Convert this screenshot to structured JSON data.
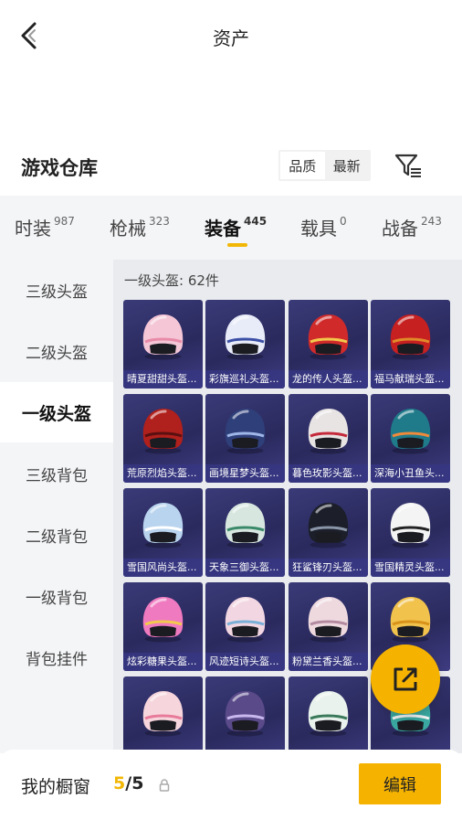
{
  "header": {
    "title": "资产"
  },
  "section": {
    "title": "游戏仓库"
  },
  "sort": {
    "options": [
      "品质",
      "最新"
    ],
    "active": "品质"
  },
  "tabs": [
    {
      "label": "时装",
      "count": "987"
    },
    {
      "label": "枪械",
      "count": "323"
    },
    {
      "label": "装备",
      "count": "445",
      "active": true
    },
    {
      "label": "载具",
      "count": "0"
    },
    {
      "label": "战备",
      "count": "243"
    }
  ],
  "sidebar": {
    "items": [
      {
        "label": "三级头盔"
      },
      {
        "label": "二级头盔"
      },
      {
        "label": "一级头盔",
        "active": true
      },
      {
        "label": "三级背包"
      },
      {
        "label": "二级背包"
      },
      {
        "label": "一级背包"
      },
      {
        "label": "背包挂件"
      }
    ]
  },
  "grid": {
    "header": "一级头盔: 62件",
    "items": [
      {
        "name": "晴夏甜甜头盔...",
        "color": "#f4c6d6",
        "accent": "#e88aa8"
      },
      {
        "name": "彩旗巡礼头盔...",
        "color": "#e8ecf8",
        "accent": "#3b4fa6"
      },
      {
        "name": "龙的传人头盔...",
        "color": "#d12a2a",
        "accent": "#f2c94c"
      },
      {
        "name": "福马献瑞头盔...",
        "color": "#c62020",
        "accent": "#e08a2a"
      },
      {
        "name": "荒原烈焰头盔...",
        "color": "#b0201c",
        "accent": "#5a1010"
      },
      {
        "name": "画境星梦头盔...",
        "color": "#2f3f7a",
        "accent": "#9fb6e8"
      },
      {
        "name": "暮色玫影头盔...",
        "color": "#e8e4e4",
        "accent": "#c42a3a"
      },
      {
        "name": "深海小丑鱼头...",
        "color": "#1f7a8a",
        "accent": "#f08a3a"
      },
      {
        "name": "雪国风尚头盔...",
        "color": "#b9d4ee",
        "accent": "#ffffff"
      },
      {
        "name": "天象三御头盔...",
        "color": "#d7e7df",
        "accent": "#3a8a6a"
      },
      {
        "name": "狂鲨锋刃头盔...",
        "color": "#1c1f2a",
        "accent": "#8a96a8"
      },
      {
        "name": "雪国精灵头盔...",
        "color": "#f4f4f4",
        "accent": "#222222"
      },
      {
        "name": "炫彩糖果头盔...",
        "color": "#f07ac0",
        "accent": "#f2c94c"
      },
      {
        "name": "风迹短诗头盔...",
        "color": "#f2d7e2",
        "accent": "#7ab0d8"
      },
      {
        "name": "粉黛兰香头盔...",
        "color": "#eed9df",
        "accent": "#b38aa0"
      },
      {
        "name": "",
        "color": "#f1c24c",
        "accent": "#d8921a"
      },
      {
        "name": "",
        "color": "#f6d6dc",
        "accent": "#e87a9a"
      },
      {
        "name": "",
        "color": "#5a4a8a",
        "accent": "#c9b8ee"
      },
      {
        "name": "",
        "color": "#e9f2ec",
        "accent": "#3a7a5a"
      },
      {
        "name": "",
        "color": "#3aa8a0",
        "accent": "#f2f2f2"
      }
    ]
  },
  "bottom": {
    "label": "我的橱窗",
    "current": "5",
    "sep": "/",
    "total": "5",
    "edit_label": "编辑"
  },
  "colors": {
    "accent": "#f5b300",
    "card_bg": "#2e2e66"
  }
}
